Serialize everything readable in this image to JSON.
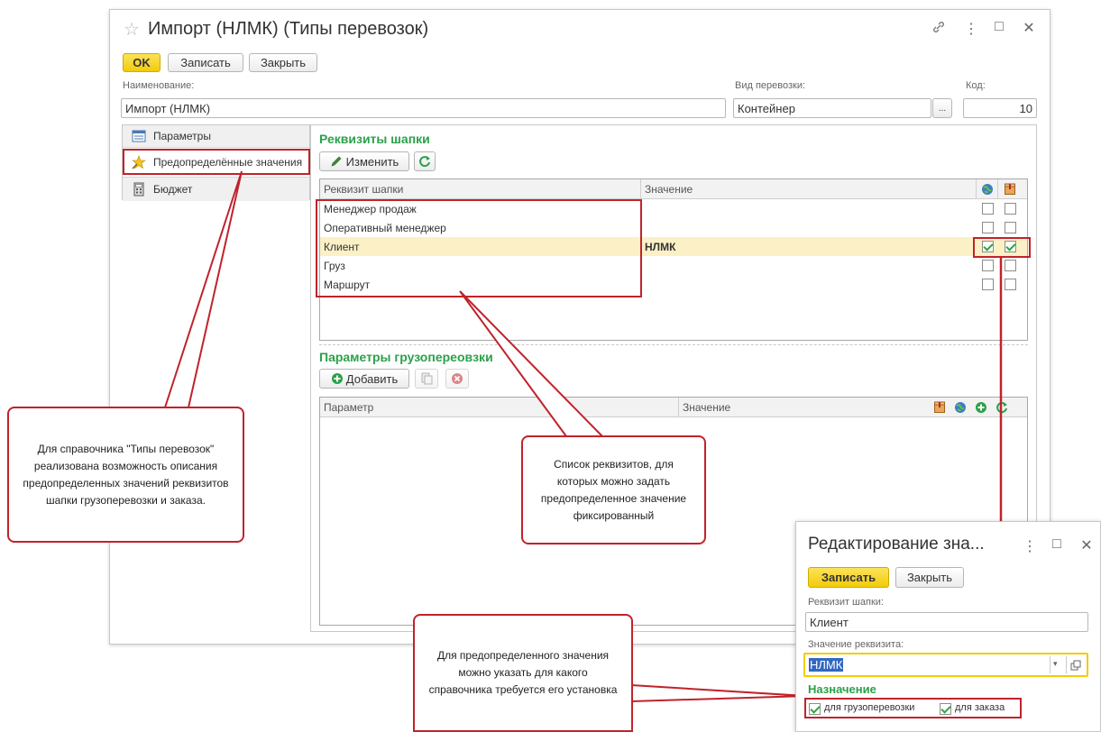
{
  "window": {
    "title": "Импорт (НЛМК) (Типы перевозок)",
    "controls": [
      "🔗",
      "⋮",
      "□",
      "✕"
    ]
  },
  "toolbar": {
    "ok_label": "OK",
    "save_label": "Записать",
    "close_label": "Закрыть"
  },
  "form": {
    "name_label": "Наименование:",
    "name_value": "Импорт (НЛМК)",
    "transport_label": "Вид перевозки:",
    "transport_value": "Контейнер",
    "transport_select": "...",
    "code_label": "Код:",
    "code_value": "10"
  },
  "nav": {
    "items": [
      {
        "label": "Параметры",
        "icon": "parameters-icon"
      },
      {
        "label": "Предопределённые значения",
        "icon": "star-icon"
      },
      {
        "label": "Бюджет",
        "icon": "calculator-icon"
      }
    ]
  },
  "header_props": {
    "title": "Реквизиты шапки",
    "edit_label": "Изменить",
    "columns": [
      "Реквизит шапки",
      "Значение"
    ],
    "rows": [
      {
        "name": "Менеджер продаж",
        "value": "",
        "c1": false,
        "c2": false
      },
      {
        "name": "Оперативный менеджер",
        "value": "",
        "c1": false,
        "c2": false
      },
      {
        "name": "Клиент",
        "value": "НЛМК",
        "c1": true,
        "c2": true
      },
      {
        "name": "Груз",
        "value": "",
        "c1": false,
        "c2": false
      },
      {
        "name": "Маршрут",
        "value": "",
        "c1": false,
        "c2": false
      }
    ]
  },
  "cargo_params": {
    "title": "Параметры грузопереовзки",
    "add_label": "Добавить",
    "columns": [
      "Параметр",
      "Значение"
    ]
  },
  "callouts": {
    "left": "Для справочника \"Типы перевозок\" реализована возможность описания предопределенных значений реквизитов шапки грузоперевозки и заказа.",
    "middle": "Список реквизитов, для которых можно задать предопределенное значение фиксированный",
    "bottom": "Для предопределенного значения можно указать для какого справочника требуется его установка"
  },
  "dialog": {
    "title": "Редактирование зна...",
    "controls": [
      "⋮",
      "□",
      "✕"
    ],
    "save_label": "Записать",
    "close_label": "Закрыть",
    "prop_label": "Реквизит шапки:",
    "prop_value": "Клиент",
    "value_label": "Значение реквизита:",
    "value_value": "НЛМК",
    "assign_title": "Назначение",
    "for_cargo_label": "для грузоперевозки",
    "for_order_label": "для заказа",
    "for_cargo": true,
    "for_order": true
  },
  "colors": {
    "accent_green": "#2ba14a",
    "annotation_red": "#c0232b",
    "button_yellow": "#f2cb09",
    "selected_row": "#fbf0c6"
  }
}
